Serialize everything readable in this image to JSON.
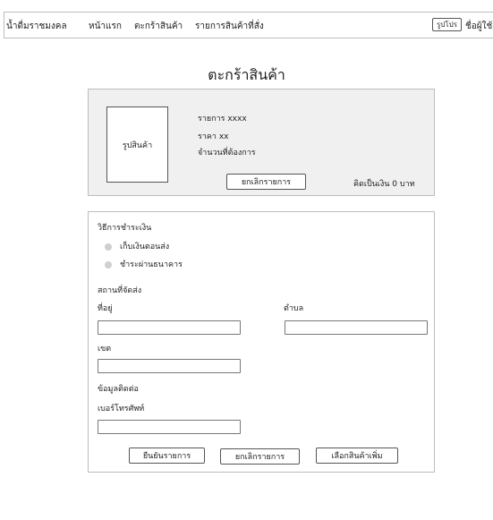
{
  "nav": {
    "brand": "น้ำดื่มราชมงคล",
    "home": "หน้าแรก",
    "cart": "ตะกร้าสินค้า",
    "orders": "รายการสินค้าที่สั่ง",
    "profile_photo": "รูปโปร",
    "username": "ชื่อผู้ใช้"
  },
  "page": {
    "title": "ตะกร้าสินค้า"
  },
  "cart_item": {
    "image_label": "รูปสินค้า",
    "item": "รายการ xxxx",
    "price": "ราคา xx",
    "quantity": "จำนวนที่ต้องการ",
    "cancel_item_button": "ยกเลิกรายการ",
    "total": "คิดเป็นเงิน  0 บาท"
  },
  "checkout": {
    "payment_heading": "วิธีการชำระเงิน",
    "payment_options": [
      "เก็บเงินตอนส่ง",
      "ชำระผ่านธนาคาร"
    ],
    "shipping_heading": "สถานที่จัดส่ง",
    "address_label": "ที่อยู่",
    "subdistrict_label": "ตำบล",
    "district_label": "เขต",
    "contact_heading": "ข้อมูลติดต่อ",
    "phone_label": "เบอร์โทรศัพท์",
    "confirm_button": "ยืนยันรายการ",
    "cancel_button": "ยกเลิกรายการ",
    "more_products_button": "เลือกสินค้าเพิ่ม"
  }
}
